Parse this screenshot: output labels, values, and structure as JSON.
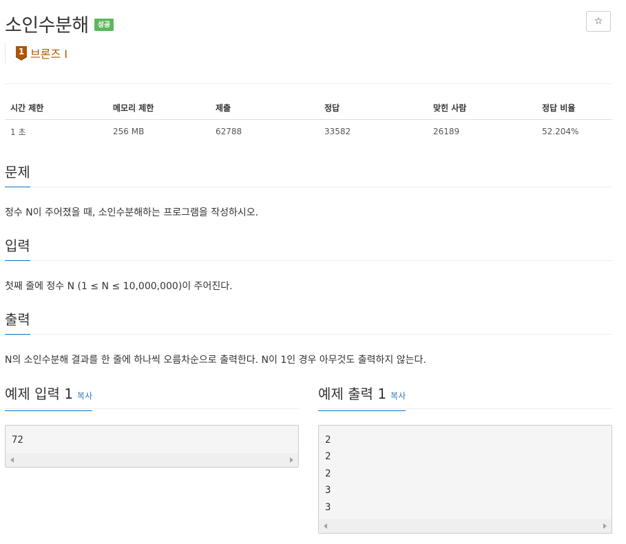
{
  "header": {
    "title": "소인수분해",
    "status_badge": "성공",
    "star_label": "☆",
    "tier_number": "1",
    "tier_label": "브론즈 I",
    "tier_color": "#ad5600"
  },
  "info_table": {
    "headers": [
      "시간 제한",
      "메모리 제한",
      "제출",
      "정답",
      "맞힌 사람",
      "정답 비율"
    ],
    "values": [
      "1 초",
      "256 MB",
      "62788",
      "33582",
      "26189",
      "52.204%"
    ]
  },
  "problem": {
    "title": "문제",
    "text": "정수 N이 주어졌을 때, 소인수분해하는 프로그램을 작성하시오."
  },
  "input": {
    "title": "입력",
    "text": "첫째 줄에 정수 N (1 ≤ N ≤ 10,000,000)이 주어진다."
  },
  "output": {
    "title": "출력",
    "text": "N의 소인수분해 결과를 한 줄에 하나씩 오름차순으로 출력한다. N이 1인 경우 아무것도 출력하지 않는다."
  },
  "samples": {
    "input_title": "예제 입력 1",
    "output_title": "예제 출력 1",
    "copy_label": "복사",
    "input_lines": [
      "72"
    ],
    "output_lines": [
      "2",
      "2",
      "2",
      "3",
      "3"
    ]
  }
}
